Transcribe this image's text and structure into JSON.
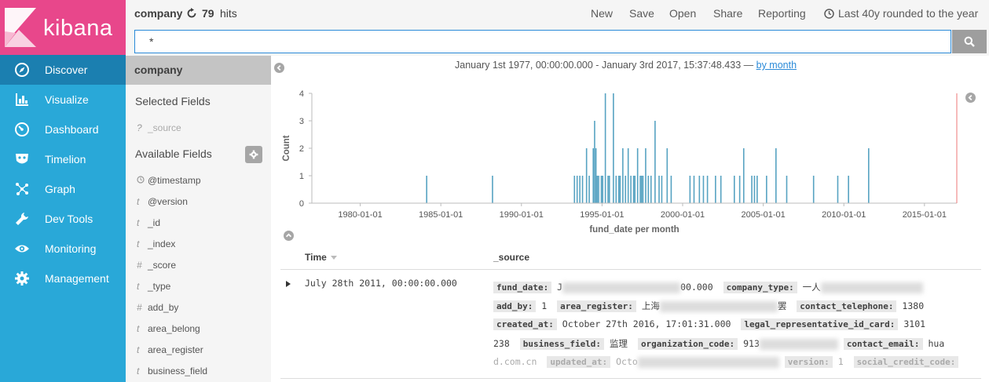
{
  "app": {
    "logo_text": "kibana"
  },
  "nav": {
    "items": [
      {
        "label": "Discover",
        "icon": "compass-icon",
        "active": true
      },
      {
        "label": "Visualize",
        "icon": "bar-chart-icon"
      },
      {
        "label": "Dashboard",
        "icon": "dashboard-gauge-icon"
      },
      {
        "label": "Timelion",
        "icon": "timelion-mask-icon"
      },
      {
        "label": "Graph",
        "icon": "graph-network-icon"
      },
      {
        "label": "Dev Tools",
        "icon": "wrench-icon"
      },
      {
        "label": "Monitoring",
        "icon": "eye-icon"
      },
      {
        "label": "Management",
        "icon": "gear-icon"
      }
    ]
  },
  "topbar": {
    "index": "company",
    "hits": "79",
    "hits_label": "hits",
    "menu": {
      "new": "New",
      "save": "Save",
      "open": "Open",
      "share": "Share",
      "reporting": "Reporting",
      "time": "Last 40y rounded to the year"
    }
  },
  "search": {
    "query": "*"
  },
  "sidebar": {
    "index": "company",
    "selected_title": "Selected Fields",
    "selected": [
      {
        "type": "?",
        "name": "_source"
      }
    ],
    "available_title": "Available Fields",
    "fields": [
      {
        "type": "clock",
        "name": "@timestamp"
      },
      {
        "type": "t",
        "name": "@version"
      },
      {
        "type": "t",
        "name": "_id"
      },
      {
        "type": "t",
        "name": "_index"
      },
      {
        "type": "#",
        "name": "_score"
      },
      {
        "type": "t",
        "name": "_type"
      },
      {
        "type": "#",
        "name": "add_by"
      },
      {
        "type": "t",
        "name": "area_belong"
      },
      {
        "type": "t",
        "name": "area_register"
      },
      {
        "type": "t",
        "name": "business_field"
      }
    ]
  },
  "histogram": {
    "range_text": "January 1st 1977, 00:00:00.000 - January 3rd 2017, 15:37:48.433 —",
    "interval": "by month"
  },
  "chart_data": {
    "type": "bar",
    "xlabel": "fund_date per month",
    "ylabel": "Count",
    "ylim": [
      0,
      4
    ],
    "xlim": [
      "1977-01-01",
      "2017-01-03"
    ],
    "y_ticks": [
      0,
      1,
      2,
      3,
      4
    ],
    "x_ticks": [
      "1980-01-01",
      "1985-01-01",
      "1990-01-01",
      "1995-01-01",
      "2000-01-01",
      "2005-01-01",
      "2010-01-01",
      "2015-01-01"
    ],
    "x": [
      "1984-02",
      "1988-03",
      "1993-04",
      "1993-06",
      "1993-08",
      "1993-10",
      "1994-01",
      "1994-03",
      "1994-06",
      "1994-07",
      "1994-08",
      "1994-09",
      "1994-10",
      "1994-12",
      "1995-01",
      "1995-03",
      "1995-05",
      "1995-06",
      "1995-09",
      "1995-11",
      "1996-01",
      "1996-02",
      "1996-04",
      "1996-06",
      "1996-08",
      "1996-10",
      "1996-12",
      "1997-01",
      "1997-03",
      "1997-05",
      "1997-06",
      "1997-07",
      "1997-09",
      "1997-11",
      "1998-01",
      "1998-04",
      "1998-07",
      "1998-09",
      "1999-01",
      "1999-04",
      "2000-06",
      "2000-09",
      "2001-01",
      "2001-04",
      "2001-07",
      "2002-01",
      "2002-05",
      "2003-03",
      "2003-07",
      "2003-10",
      "2004-04",
      "2004-06",
      "2004-08",
      "2005-03",
      "2005-10",
      "2006-06",
      "2008-02",
      "2009-08",
      "2010-04",
      "2011-07"
    ],
    "values": [
      1,
      1,
      1,
      1,
      1,
      1,
      2,
      1,
      2,
      3,
      2,
      1,
      1,
      1,
      1,
      4,
      1,
      1,
      4,
      1,
      1,
      1,
      2,
      1,
      2,
      1,
      1,
      1,
      2,
      1,
      1,
      1,
      2,
      1,
      1,
      3,
      1,
      1,
      2,
      1,
      1,
      1,
      1,
      1,
      1,
      1,
      1,
      1,
      1,
      2,
      1,
      1,
      1,
      1,
      2,
      1,
      1,
      1,
      1,
      2
    ]
  },
  "table": {
    "col_time": "Time",
    "col_source": "_source",
    "row_time": "July 28th 2011, 00:00:00.000",
    "source": {
      "fund_date_key": "fund_date:",
      "fund_date_val_start": "J",
      "fund_date_val_end": "00.000",
      "company_type_key": "company_type:",
      "company_type_val": "一人",
      "add_by_key": "add_by:",
      "add_by_val": "1",
      "area_register_key": "area_register:",
      "area_register_val": "上海",
      "area_register_tail": "罢",
      "contact_telephone_key": "contact_telephone:",
      "contact_telephone_val": "1380",
      "created_at_key": "created_at:",
      "created_at_val": "October 27th 2016, 17:01:31.000",
      "legal_rep_key": "legal_representative_id_card:",
      "legal_rep_val": "3101",
      "line4_lead": "238",
      "business_field_key": "business_field:",
      "business_field_val": "监理",
      "org_code_key": "organization_code:",
      "org_code_val": "913",
      "contact_email_key": "contact_email:",
      "contact_email_val": "hua",
      "line5_lead": "d.com.cn",
      "updated_at_key": "updated_at:",
      "updated_at_val": "Octo",
      "version_key": "version:",
      "version_val": "1",
      "social_credit_key": "social_credit_code:"
    }
  }
}
